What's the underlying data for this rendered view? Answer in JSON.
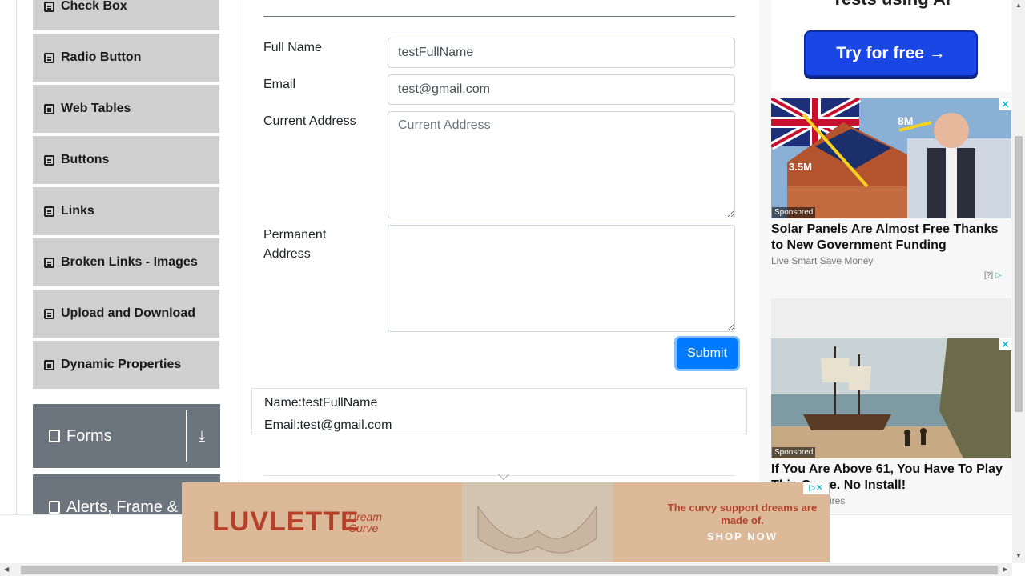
{
  "sidebar": {
    "items": [
      {
        "label": "Check Box"
      },
      {
        "label": "Radio Button"
      },
      {
        "label": "Web Tables"
      },
      {
        "label": "Buttons"
      },
      {
        "label": "Links"
      },
      {
        "label": "Broken Links - Images"
      },
      {
        "label": "Upload and Download"
      },
      {
        "label": "Dynamic Properties"
      }
    ],
    "groups": [
      {
        "label": "Forms"
      },
      {
        "label": "Alerts, Frame &"
      }
    ]
  },
  "form": {
    "full_name_label": "Full Name",
    "full_name_value": "testFullName",
    "email_label": "Email",
    "email_value": "test@gmail.com",
    "current_address_label": "Current Address",
    "current_address_placeholder": "Current Address",
    "permanent_address_label": "Permanent Address",
    "submit_label": "Submit"
  },
  "output": {
    "name_line": "Name:testFullName",
    "email_line": "Email:test@gmail.com"
  },
  "ads": {
    "top_title": "Tests using AI",
    "top_button": "Try for free →",
    "ad1": {
      "sponsored": "Sponsored",
      "title": "Solar Panels Are Almost Free Thanks to New Government Funding",
      "source": "Live Smart Save Money",
      "adchoice": "[?]",
      "image_text_1": "8M",
      "image_text_2": "3.5M"
    },
    "ad2": {
      "sponsored": "Sponsored",
      "title": "If You Are Above 61, You Have To Play This Game. No Install!",
      "source": "ires",
      "adchoice": "[?]"
    },
    "banner": {
      "brand": "LUVLETTE",
      "sub": "Dream Curve",
      "tagline": "The curvy support dreams are made of.",
      "cta": "SHOP NOW"
    }
  },
  "colors": {
    "primary": "#007bff",
    "sidebar_item": "#cfcfcf",
    "group": "#6c757d"
  }
}
